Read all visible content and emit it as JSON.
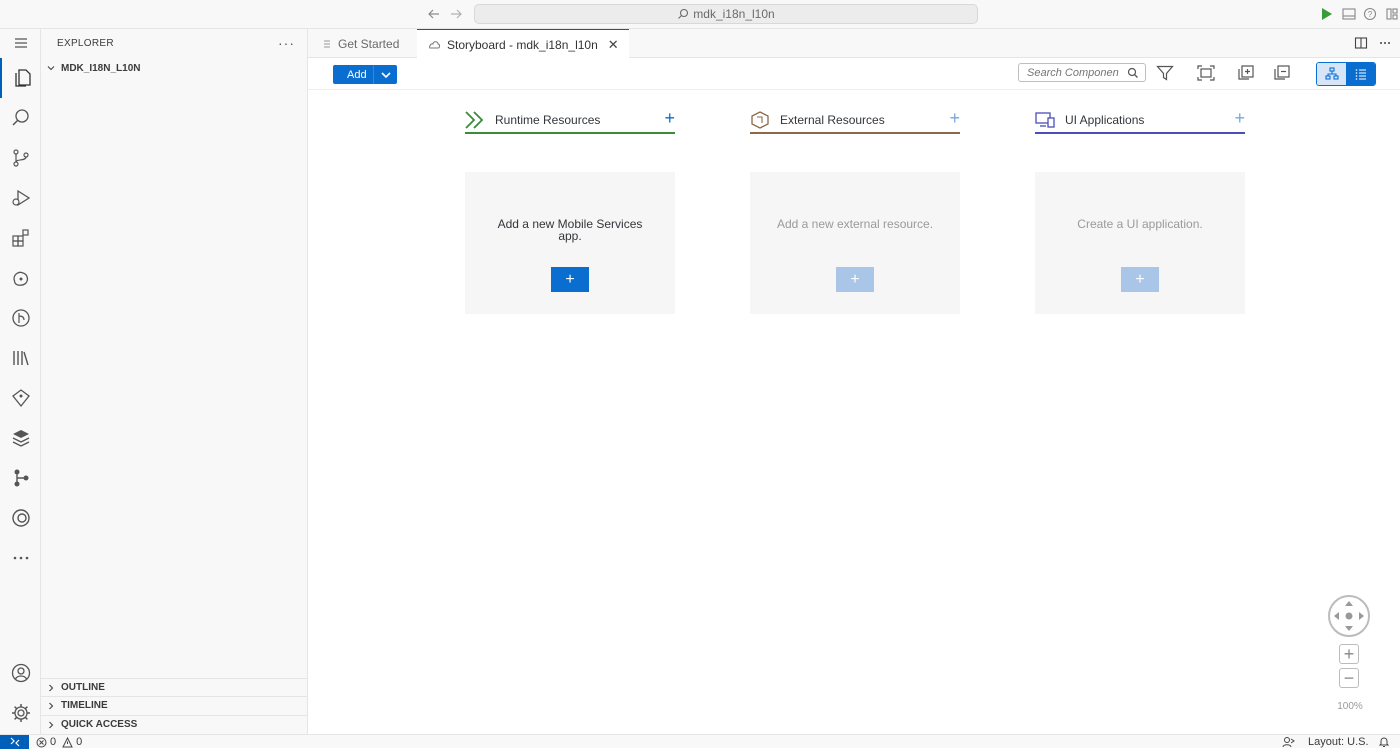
{
  "window": {
    "command_center": "mdk_i18n_l10n"
  },
  "activity_bar": {
    "items": [
      "explorer-icon",
      "search-icon",
      "source-control-icon",
      "run-debug-icon",
      "extensions-icon",
      "sap-cloud-icon",
      "git-graph-icon",
      "library-icon",
      "gem-icon",
      "layers-icon",
      "branch-icon",
      "copilot-icon",
      "more-icon"
    ],
    "bottom": [
      "account-icon",
      "manage-gear-icon"
    ]
  },
  "sidebar": {
    "title": "EXPLORER",
    "more": "···",
    "root_folder": "MDK_I18N_L10N",
    "sections": [
      "OUTLINE",
      "TIMELINE",
      "QUICK ACCESS"
    ]
  },
  "tabs": [
    {
      "label": "Get Started",
      "active": false
    },
    {
      "label": "Storyboard - mdk_i18n_l10n",
      "active": true
    }
  ],
  "toolbar": {
    "add_label": "Add",
    "search_placeholder": "Search Componen"
  },
  "columns": [
    {
      "title": "Runtime Resources",
      "plus": "+",
      "accent": "#3a8b3a",
      "message": "Add a new Mobile Services app.",
      "button": "+",
      "enabled": true
    },
    {
      "title": "External Resources",
      "plus": "+",
      "accent": "#8a6a48",
      "message": "Add a new external resource.",
      "button": "+",
      "enabled": false
    },
    {
      "title": "UI Applications",
      "plus": "+",
      "accent": "#4a4ebb",
      "message": "Create a UI application.",
      "button": "+",
      "enabled": false
    }
  ],
  "zoom": {
    "plus": "+",
    "minus": "−",
    "level": "100%"
  },
  "status": {
    "errors": "0",
    "warnings": "0",
    "layout": "Layout: U.S."
  },
  "colors": {
    "primary": "#0a6ed1",
    "vscode_accent": "#005fb8",
    "disabled_button": "#9dbfe6",
    "run_green": "#3a9b3a"
  }
}
